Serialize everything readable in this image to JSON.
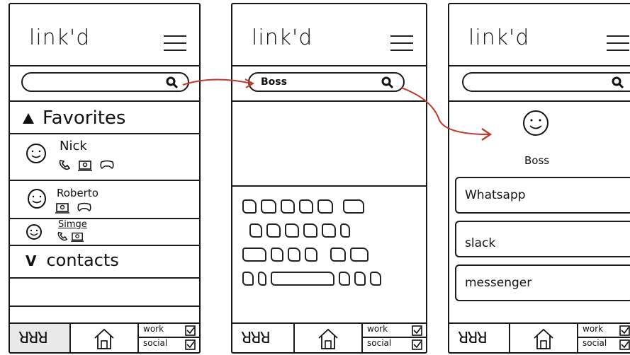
{
  "colors": {
    "ink": "#111111",
    "arrow": "#c0392b",
    "active_tab": "#e9e9e9"
  },
  "screen1": {
    "logo": "link'd",
    "search": {
      "value": ""
    },
    "favorites_title": "Favorites",
    "contacts": [
      {
        "name": "Nick",
        "icons": [
          "phone-icon",
          "video-icon",
          "gamepad-icon"
        ]
      },
      {
        "name": "Roberto",
        "icons": [
          "video-icon",
          "gamepad-icon"
        ]
      },
      {
        "name": "Simge",
        "icons": [
          "phone-icon",
          "video-icon"
        ]
      }
    ],
    "contacts_title": "contacts"
  },
  "screen2": {
    "logo": "link'd",
    "search": {
      "value": "Boss"
    }
  },
  "screen3": {
    "logo": "link'd",
    "search": {
      "value": ""
    },
    "contact_name": "Boss",
    "apps": [
      "Whatsapp",
      "slack",
      "messenger"
    ]
  },
  "tabbar": {
    "people": "ꓤꓤꓤ",
    "work": "work",
    "social": "social"
  }
}
